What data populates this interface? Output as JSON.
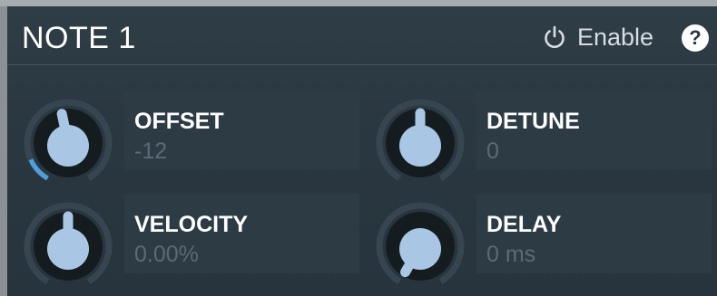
{
  "header": {
    "title": "NOTE 1",
    "enable_label": "Enable",
    "help_label": "?"
  },
  "knobs": [
    {
      "name": "OFFSET",
      "value": "-12",
      "level": 0.46,
      "ring": 0.12,
      "ring_start": 0.0
    },
    {
      "name": "DETUNE",
      "value": "0",
      "level": 0.5,
      "ring": 0.0,
      "ring_start": 0.5
    },
    {
      "name": "VELOCITY",
      "value": "0.00%",
      "level": 0.5,
      "ring": 0.0,
      "ring_start": 0.5
    },
    {
      "name": "DELAY",
      "value": "0 ms",
      "level": 0.0,
      "ring": 0.0,
      "ring_start": 0.0
    }
  ],
  "colors": {
    "accent": "#4aa3e0",
    "knob_fill": "#a9c7e4",
    "knob_body": "#151c20",
    "track": "#36454f"
  },
  "icons": {
    "power": "power-icon",
    "help": "help-icon"
  }
}
